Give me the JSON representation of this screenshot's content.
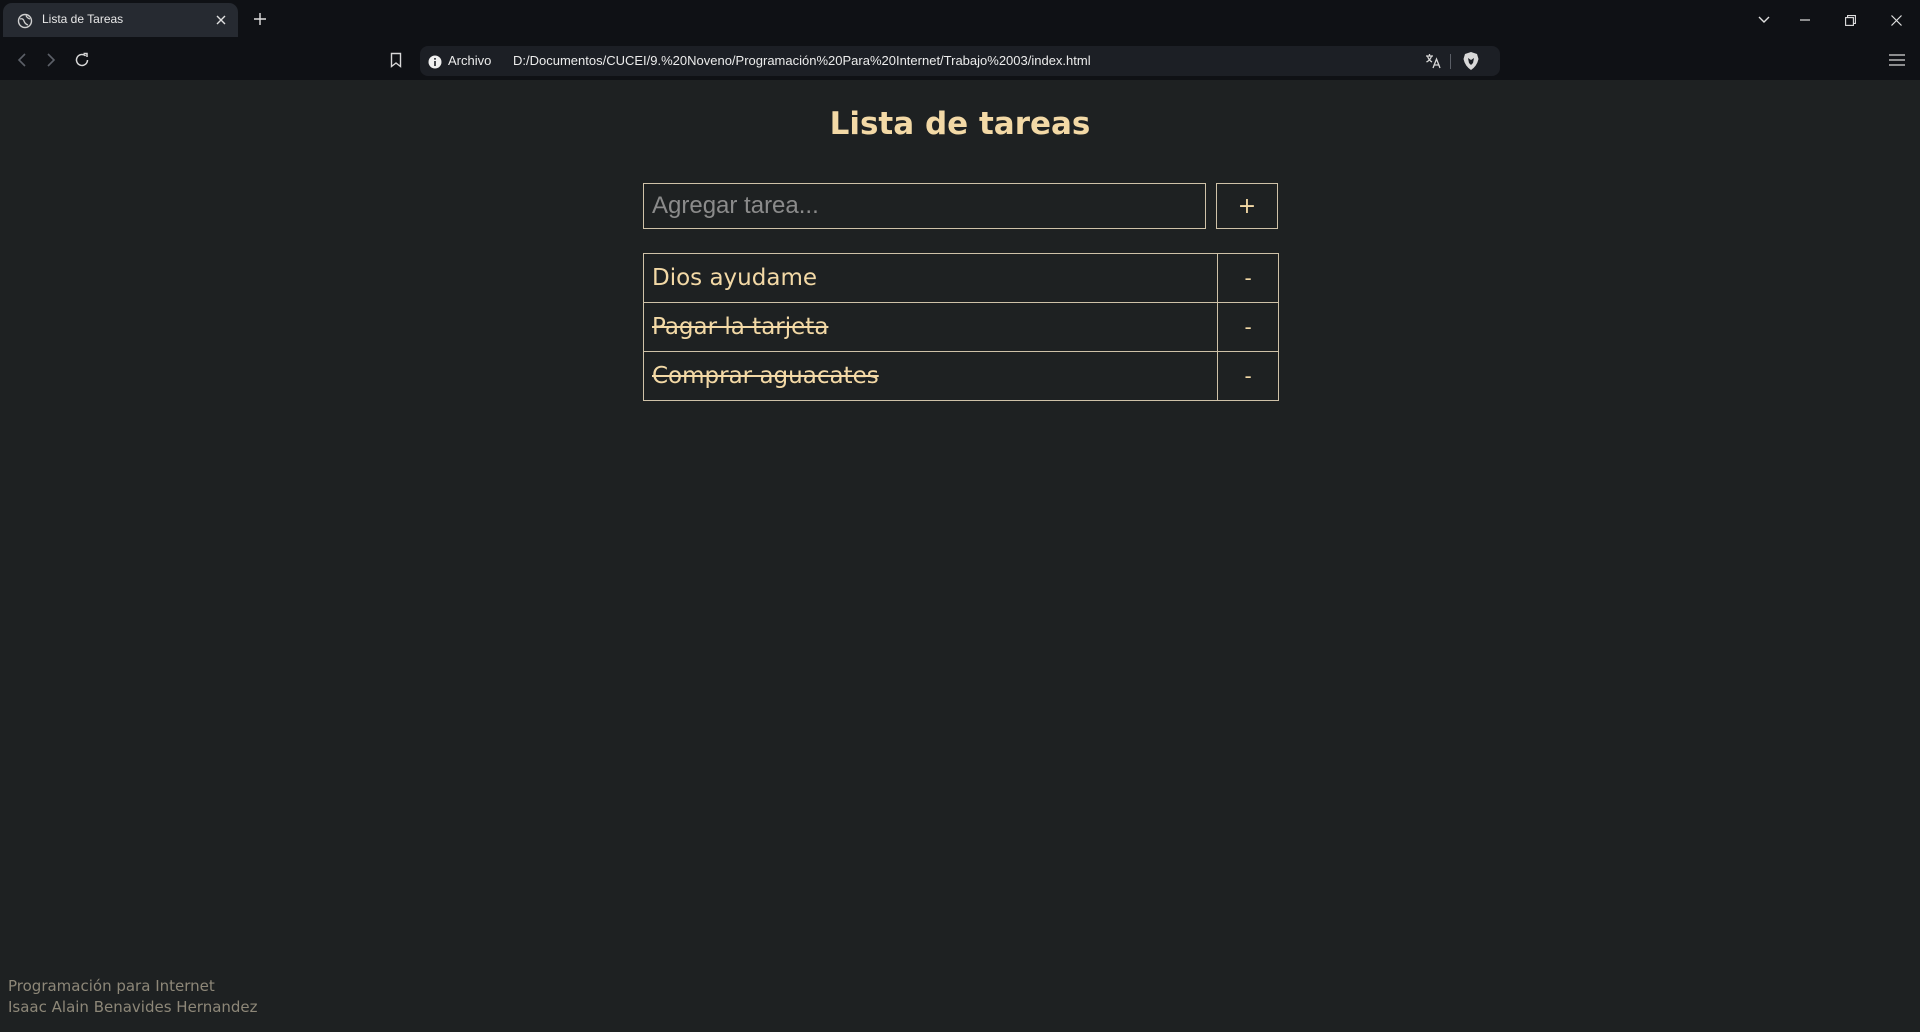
{
  "browser": {
    "tab_title": "Lista de Tareas",
    "url_scheme": "Archivo",
    "url": "D:/Documentos/CUCEI/9.%20Noveno/Programación%20Para%20Internet/Trabajo%2003/index.html"
  },
  "page": {
    "title": "Lista de tareas",
    "input_placeholder": "Agregar tarea...",
    "add_label": "+",
    "tasks": [
      {
        "text": "Dios ayudame",
        "done": false,
        "remove_label": "-"
      },
      {
        "text": "Pagar la tarjeta",
        "done": true,
        "remove_label": "-"
      },
      {
        "text": "Comprar aguacates",
        "done": true,
        "remove_label": "-"
      }
    ]
  },
  "footer": {
    "line1": "Programación para Internet",
    "line2": "Isaac Alain Benavides Hernandez"
  },
  "colors": {
    "accent": "#f3d9a6",
    "background": "#1e2122",
    "chrome": "#0f1115"
  }
}
